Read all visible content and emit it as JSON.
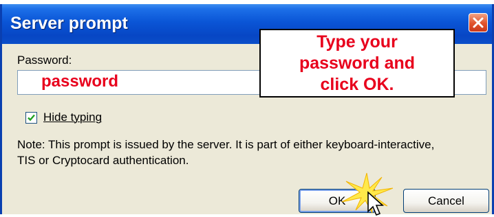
{
  "window": {
    "title": "Server prompt"
  },
  "form": {
    "password_label": "Password:",
    "password_value": "password",
    "hide_typing_label": "Hide typing",
    "hide_typing_checked": true,
    "note_line1": "Note: This prompt is issued by the server. It is part of either keyboard-interactive,",
    "note_line2": "TIS or Cryptocard authentication."
  },
  "callout": {
    "line1": "Type your",
    "line2": "password and",
    "line3": "click OK."
  },
  "buttons": {
    "ok_label": "OK",
    "cancel_label": "Cancel"
  },
  "icons": {
    "close": "close-x-icon",
    "checkbox": "checkmark-icon",
    "cursor": "mouse-pointer-icon",
    "highlight": "click-burst-icon"
  },
  "colors": {
    "title_bar": "#0a55d6",
    "annotation_red": "#e8001c",
    "dialog_background": "#ece9d8"
  }
}
